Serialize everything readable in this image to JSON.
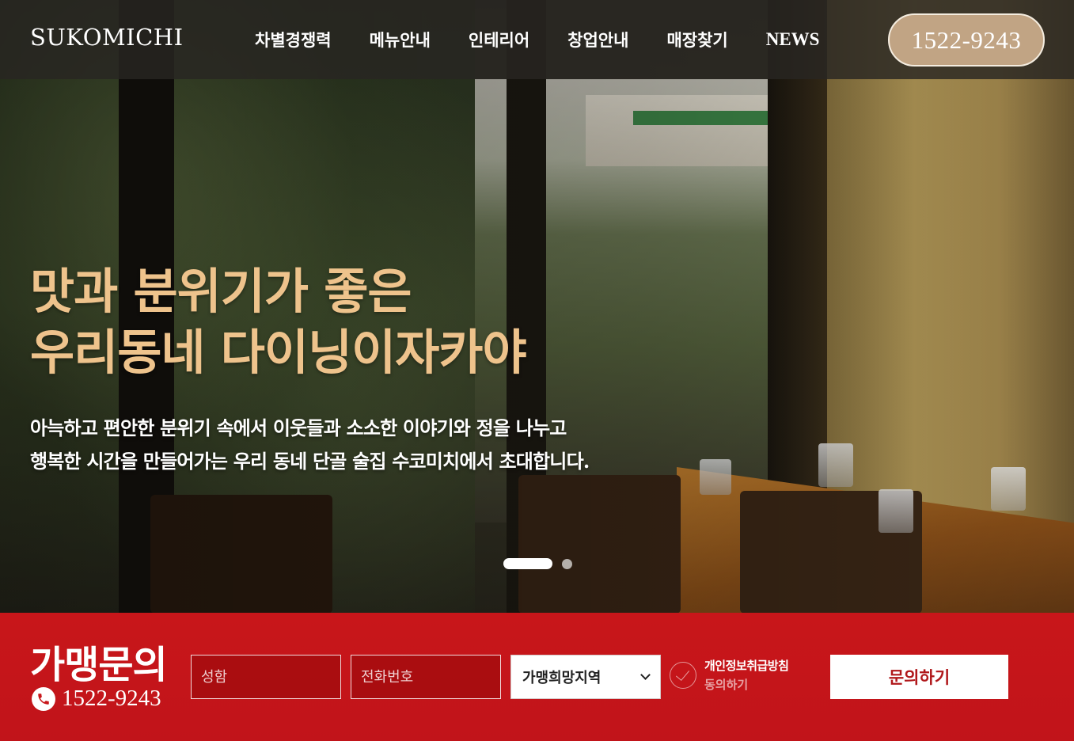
{
  "header": {
    "logo": "SUKOMICHI",
    "nav": [
      "차별경쟁력",
      "메뉴안내",
      "인테리어",
      "창업안내",
      "매장찾기",
      "NEWS"
    ],
    "phone": "1522-9243"
  },
  "hero": {
    "headline_line1": "맛과 분위기가 좋은",
    "headline_line2": "우리동네 다이닝이자카야",
    "sub_line1": "아늑하고 편안한 분위기 속에서 이웃들과 소소한 이야기와 정을 나누고",
    "sub_line2": "행복한 시간을 만들어가는 우리 동네 단골 술집 수코미치에서 초대합니다.",
    "slide_current": 1,
    "slide_total": 2
  },
  "inquiry": {
    "title": "가맹문의",
    "phone": "1522-9243",
    "name_placeholder": "성함",
    "phone_placeholder": "전화번호",
    "region_value": "가맹희망지역",
    "privacy_line1": "개인정보취급방침",
    "privacy_line2": "동의하기",
    "submit_label": "문의하기"
  },
  "colors": {
    "accent_gold": "#eec38c",
    "pill_bg": "#c1a484",
    "inquiry_red": "#c8161a"
  }
}
